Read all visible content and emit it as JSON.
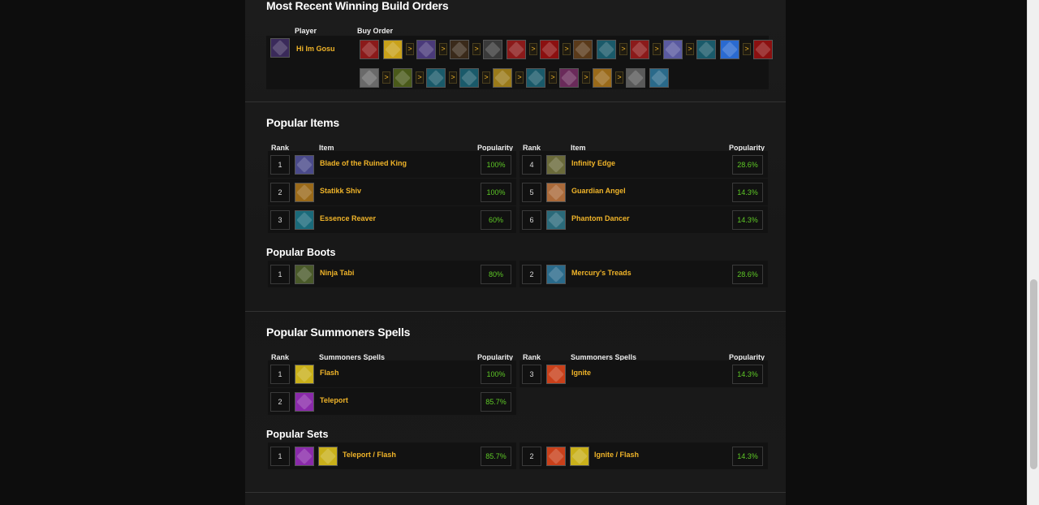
{
  "build_orders": {
    "title": "Most Recent Winning Build Orders",
    "col_player": "Player",
    "col_buy_order": "Buy Order",
    "player_name": "Hi Im Gosu",
    "row1_colors": [
      "#8b1a1a",
      "#c9a11a",
      "#4a3a7a",
      "#3a2a1a",
      "#3a3a3a",
      "#8b1a1a",
      "#8b1010",
      "#5a3a1a",
      "#1a5a6a",
      "#8b1a1a",
      "#5a5aa0",
      "#1a5a6a",
      "#2a6ad0",
      "#8b1010"
    ],
    "row1_arrows_after": [
      2,
      3,
      4,
      6,
      7,
      9,
      10,
      11,
      13
    ],
    "row2_colors": [
      "#6a6a6a",
      "#4a5a1a",
      "#1a5a6a",
      "#1a5a6a",
      "#9a7a1a",
      "#1a5a6a",
      "#6a2a5a",
      "#9a6a1a",
      "#5a5a5a",
      "#2a6a8a"
    ],
    "row2_arrows_after": [
      1,
      2,
      3,
      4,
      5,
      6,
      7,
      8
    ],
    "arrow_glyph": ">"
  },
  "popular_items": {
    "title": "Popular Items",
    "headers": {
      "rank": "Rank",
      "item": "Item",
      "popularity": "Popularity"
    },
    "left": [
      {
        "rank": "1",
        "name": "Blade of the Ruined King",
        "pop": "100%",
        "color": "#4a4a8a"
      },
      {
        "rank": "2",
        "name": "Statikk Shiv",
        "pop": "100%",
        "color": "#9a6a1a"
      },
      {
        "rank": "3",
        "name": "Essence Reaver",
        "pop": "60%",
        "color": "#1a6a7a"
      }
    ],
    "right": [
      {
        "rank": "4",
        "name": "Infinity Edge",
        "pop": "28.6%",
        "color": "#6a6a3a"
      },
      {
        "rank": "5",
        "name": "Guardian Angel",
        "pop": "14.3%",
        "color": "#aa6a3a"
      },
      {
        "rank": "6",
        "name": "Phantom Dancer",
        "pop": "14.3%",
        "color": "#2a6a7a"
      }
    ]
  },
  "popular_boots": {
    "title": "Popular Boots",
    "left": {
      "rank": "1",
      "name": "Ninja Tabi",
      "pop": "80%",
      "color": "#4a5a2a"
    },
    "right": {
      "rank": "2",
      "name": "Mercury's Treads",
      "pop": "28.6%",
      "color": "#2a6a8a"
    }
  },
  "summoner_spells": {
    "title": "Popular Summoners Spells",
    "headers": {
      "rank": "Rank",
      "spell": "Summoners Spells",
      "popularity": "Popularity"
    },
    "left": [
      {
        "rank": "1",
        "name": "Flash",
        "pop": "100%",
        "color": "#c9b01a"
      },
      {
        "rank": "2",
        "name": "Teleport",
        "pop": "85.7%",
        "color": "#8a2aaa"
      }
    ],
    "right": [
      {
        "rank": "3",
        "name": "Ignite",
        "pop": "14.3%",
        "color": "#c9401a"
      }
    ]
  },
  "popular_sets": {
    "title": "Popular Sets",
    "left": {
      "rank": "1",
      "name": "Teleport / Flash",
      "pop": "85.7%",
      "colors": [
        "#8a2aaa",
        "#c9b01a"
      ]
    },
    "right": {
      "rank": "2",
      "name": "Ignite / Flash",
      "pop": "14.3%",
      "colors": [
        "#c9401a",
        "#c9b01a"
      ]
    }
  }
}
